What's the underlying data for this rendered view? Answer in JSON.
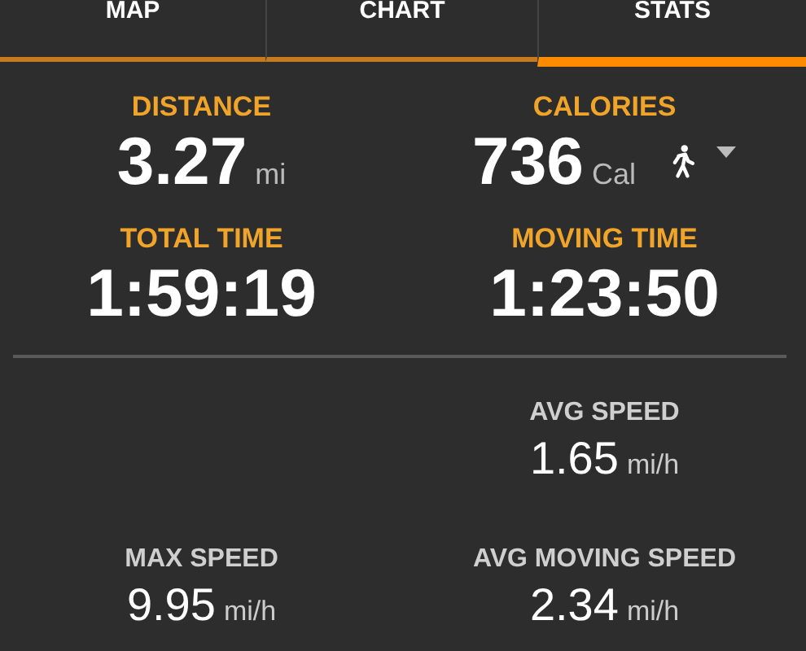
{
  "tabs": [
    {
      "label": "MAP",
      "selected": false
    },
    {
      "label": "CHART",
      "selected": false
    },
    {
      "label": "STATS",
      "selected": true
    }
  ],
  "primary_stats": [
    {
      "label": "DISTANCE",
      "value": "3.27",
      "unit": "mi"
    },
    {
      "label": "CALORIES",
      "value": "736",
      "unit": "Cal",
      "activity_picker": true
    },
    {
      "label": "TOTAL TIME",
      "value": "1:59:19"
    },
    {
      "label": "MOVING TIME",
      "value": "1:23:50"
    }
  ],
  "secondary_rows": [
    {
      "right": {
        "label": "AVG SPEED",
        "value": "1.65",
        "unit": "mi/h"
      }
    },
    {
      "left": {
        "label": "MAX SPEED",
        "value": "9.95",
        "unit": "mi/h"
      },
      "right": {
        "label": "AVG MOVING SPEED",
        "value": "2.34",
        "unit": "mi/h"
      }
    }
  ]
}
